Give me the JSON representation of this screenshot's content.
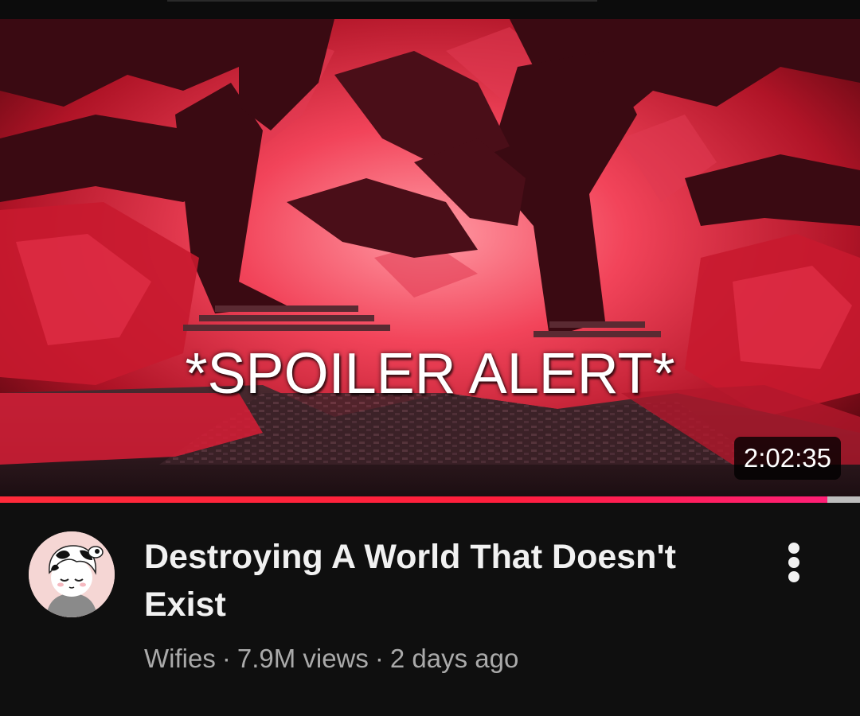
{
  "video": {
    "thumbnail_overlay_text": "*SPOILER ALERT*",
    "duration": "2:02:35",
    "watch_progress": 0.962,
    "title": "Destroying A World That Doesn't Exist",
    "channel": "Wifies",
    "views": "7.9M views",
    "age": "2 days ago",
    "separator": "·"
  },
  "icons": {
    "more_actions": "vertical-ellipsis-icon",
    "avatar": "channel-avatar"
  },
  "colors": {
    "background": "#0f0f0f",
    "progress": "#ff1e3c",
    "title_text": "#f1f1f1",
    "meta_text": "#aaaaaa"
  }
}
